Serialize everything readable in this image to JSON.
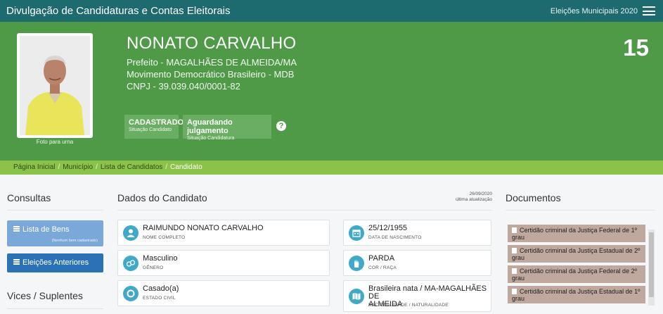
{
  "header": {
    "title": "Divulgação de Candidaturas e Contas Eleitorais",
    "election": "Eleições Municipais 2020"
  },
  "candidate": {
    "name": "NONATO CARVALHO",
    "office": "Prefeito - MAGALHÃES DE ALMEIDA/MA",
    "party": "Movimento Democrático Brasileiro - MDB",
    "cnpj": "CNPJ - 39.039.040/0001-82",
    "number": "15",
    "photo_caption": "Foto para urna",
    "status1_main": "CADASTRADO",
    "status1_sub": "Situação Candidato",
    "status2_main": "Aguardando julgamento",
    "status2_sub": "Situação Candidatura",
    "help": "?"
  },
  "breadcrumb": {
    "items": [
      "Página Inicial",
      "Município",
      "Lista de Candidatos"
    ],
    "current": "Candidato",
    "separator": "/"
  },
  "left": {
    "consultas": "Consultas",
    "bens_label": "Lista de Bens",
    "bens_note": "(Nenhum bem cadastrado)",
    "eleicoes_label": "Eleições Anteriores",
    "vices": "Vices / Suplentes"
  },
  "dados": {
    "title": "Dados do Candidato",
    "update_date": "26/09/2020",
    "update_label": "última atualização",
    "fields": {
      "nome_value": "RAIMUNDO NONATO CARVALHO",
      "nome_label": "NOME COMPLETO",
      "nasc_value": "25/12/1955",
      "nasc_label": "DATA DE NASCIMENTO",
      "genero_value": "Masculino",
      "genero_label": "GÊNERO",
      "cor_value": "PARDA",
      "cor_label": "COR / RAÇA",
      "civil_value": "Casado(a)",
      "civil_label": "ESTADO CIVIL",
      "nac_value_1": "Brasileira nata / MA-MAGALHÃES DE",
      "nac_value_2": "ALMEIDA",
      "nac_label": "NACIONALIDADE / NATURALIDADE"
    }
  },
  "documentos": {
    "title": "Documentos",
    "items": [
      {
        "line1": "Certidão criminal da Justiça Federal de 1º",
        "line2": "grau"
      },
      {
        "line1": "Certidão criminal da Justiça Estadual de 2º",
        "line2": "grau"
      },
      {
        "line1": "Certidão criminal da Justiça Federal de 2º",
        "line2": "grau"
      },
      {
        "line1": "Certidão criminal da Justiça Estadual de 1º",
        "line2": "grau"
      }
    ]
  },
  "colors": {
    "topbar": "#1e6b6f",
    "hero": "#4e9a47",
    "breadcrumb": "#8bc34a",
    "icon_circle": "#3fa9c7",
    "doc_item": "#bfa99f"
  }
}
